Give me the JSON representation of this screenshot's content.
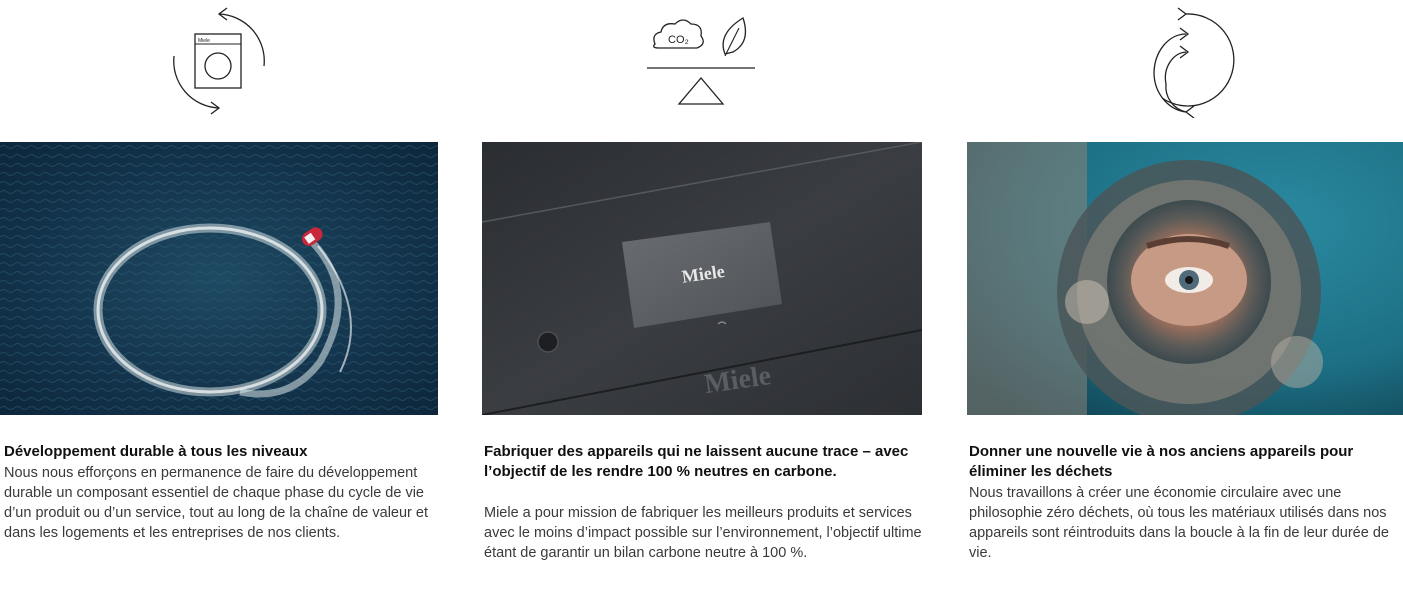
{
  "columns": [
    {
      "icon": "appliance-lifecycle-icon",
      "appliance_brand": "Miele",
      "photo_alt": "boat-circle-photo",
      "title": "Développement durable à tous les niveaux",
      "body": "Nous nous efforçons en permanence de faire du développement durable un composant essentiel de chaque phase du cycle de vie d’un produit ou d’un service, tout au long de la chaîne de valeur et dans les logements et les entreprises de nos clients."
    },
    {
      "icon": "co2-leaf-balance-icon",
      "icon_text": "CO₂",
      "photo_alt": "miele-control-panel-photo",
      "display_brand": "Miele",
      "panel_brand": "Miele",
      "title": "Fabriquer des appareils qui ne laissent aucune trace – avec l’objectif de les rendre 100 % neutres en carbone.",
      "body": "Miele a pour mission de fabriquer les meilleurs produits et services avec le moins d’impact possible sur l’environnement, l’objectif ultime étant de garantir un bilan carbone neutre à 100 %."
    },
    {
      "icon": "circular-arrows-icon",
      "photo_alt": "eye-through-lens-photo",
      "title": "Donner une nouvelle vie à nos anciens appareils pour éliminer les déchets",
      "body": "Nous travaillons à créer une économie circulaire avec une philosophie zéro déchets, où tous les matériaux utilisés dans nos appareils sont réintroduits dans la boucle à la fin de leur durée de vie."
    }
  ],
  "colors": {
    "water_dark": "#12324a",
    "panel_dark": "#2f3236",
    "teal_bg": "#1d6f84"
  }
}
